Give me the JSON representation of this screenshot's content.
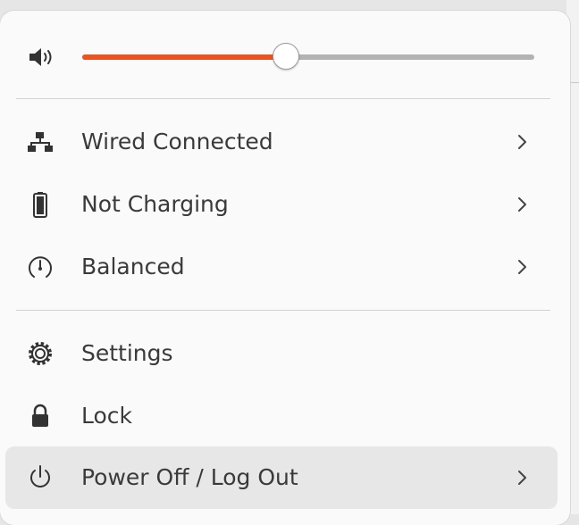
{
  "volume": {
    "icon": "speaker-volume-icon",
    "level_fraction": 0.45
  },
  "items": [
    {
      "label": "Wired Connected",
      "icon": "wired-network-icon",
      "submenu": true
    },
    {
      "label": "Not Charging",
      "icon": "battery-icon",
      "submenu": true
    },
    {
      "label": "Balanced",
      "icon": "power-mode-gauge-icon",
      "submenu": true
    },
    {
      "label": "Settings",
      "icon": "gear-icon",
      "submenu": false
    },
    {
      "label": "Lock",
      "icon": "lock-icon",
      "submenu": false
    },
    {
      "label": "Power Off / Log Out",
      "icon": "power-icon",
      "submenu": true,
      "highlighted": true
    }
  ],
  "colors": {
    "accent": "#e95420",
    "menu_background": "#fafafa",
    "hover_background": "#e7e7e7",
    "text": "#3a3a3a"
  }
}
